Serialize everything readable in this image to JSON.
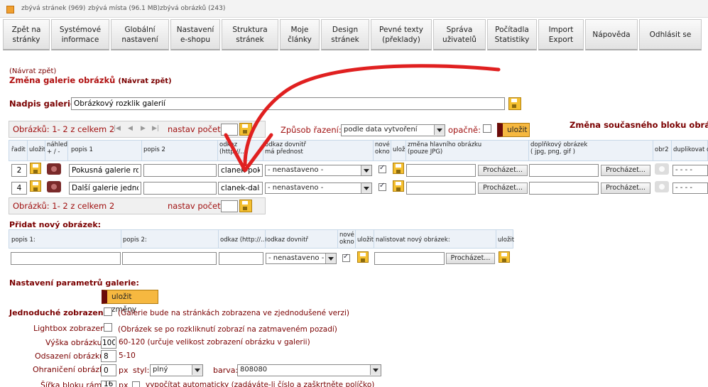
{
  "header": {
    "info": [
      "zbývá stránek (969)",
      "zbývá místa (96.1 MB)",
      "zbývá obrázků (243)"
    ]
  },
  "nav": [
    {
      "label": "Zpět na\nstránky"
    },
    {
      "label": "Systémové\ninformace"
    },
    {
      "label": "Globální\nnastavení"
    },
    {
      "label": "Nastavení\ne-shopu"
    },
    {
      "label": "Struktura\nstránek"
    },
    {
      "label": "Moje\nčlánky"
    },
    {
      "label": "Design\nstránek"
    },
    {
      "label": "Pevné texty\n(překlady)"
    },
    {
      "label": "Správa\nuživatelů"
    },
    {
      "label": "Počítadla\nStatistiky"
    },
    {
      "label": "Import\nExport"
    },
    {
      "label": "Nápověda"
    },
    {
      "label": "Odhlásit se"
    }
  ],
  "back_link": "(Návrat zpět)",
  "section_title": "Změna galerie obrázků",
  "section_back": "(Návrat zpět)",
  "gallery_title_label": "Nadpis galerie:",
  "gallery_title_value": "Obrázkový rozklik galerií",
  "pager": {
    "summary": "Obrázků: 1- 2 z celkem 2",
    "set_count_label": "nastav počet:"
  },
  "sort": {
    "label": "Způsob řazení:",
    "value": "podle data vytvoření",
    "reverse_label": "opačně:",
    "save_label": "uložit"
  },
  "right_heading": "Změna současného bloku obrázků",
  "columns": {
    "order": "řadit",
    "save": "uložit",
    "preview": "náhled\n+ / -",
    "desc1": "popis 1",
    "desc2": "popis 2",
    "link": "odkaz\n(http://...)",
    "inner_link": "odkaz dovnitř\nmá přednost",
    "new_window": "nové\nokno",
    "save2": "ulož",
    "main_image": "změna hlavního obrázku\n(pouze JPG)",
    "extra_image": "doplňkový obrázek\n( jpg, png, gif )",
    "img2": "obr2",
    "duplicate": "duplikovat d"
  },
  "rows": [
    {
      "order": "2",
      "desc1": "Pokusná galerie rozš",
      "desc2": "",
      "link": "clanek-pokus",
      "inner": "- nenastaveno -",
      "browse": "Procházet...",
      "browse2": "Procházet...",
      "dup": "- - - -"
    },
    {
      "order": "4",
      "desc1": "Další galerie jednodu",
      "desc2": "",
      "link": "clanek-dalsi-",
      "inner": "- nenastaveno -",
      "browse": "Procházet...",
      "browse2": "Procházet...",
      "dup": "- - - -"
    }
  ],
  "new_image": {
    "title": "Přidat nový obrázek:",
    "cols": {
      "desc1": "popis 1:",
      "desc2": "popis 2:",
      "link": "odkaz (http://..)",
      "inner": "odkaz dovnitř",
      "new_window": "nové\nokno",
      "save": "uložit",
      "upload": "nalistovat nový obrázek:",
      "save2": "uložit"
    },
    "inner_value": "- nenastaveno -",
    "browse": "Procházet..."
  },
  "params": {
    "title": "Nastavení parametrů galerie:",
    "save_label": "uložit změny",
    "simple_label": "Jednoduché zobrazení",
    "simple_note": "(Galerie bude na stránkách zobrazena ve zjednodušené verzi)",
    "lightbox_label": "Lightbox zobrazení",
    "lightbox_note": "(Obrázek se po rozkliknutí zobrazí na zatmaveném pozadí)",
    "height_label": "Výška obrázku:",
    "height_value": "100",
    "height_note": "60-120 (určuje velikost zobrazení obrázku v galerii)",
    "offset_label": "Odsazení obrázku:",
    "offset_value": "8",
    "offset_note": "5-10",
    "border_label": "Ohraničení obrázku",
    "border_value": "0",
    "border_unit": "px",
    "style_label": "styl:",
    "style_value": "plný",
    "color_label": "barva:",
    "color_value": "808080",
    "frame_label": "Šířka bloku rámu:",
    "frame_value": "160",
    "frame_unit": "px",
    "frame_note": "vypočítat automaticky (zadáváte-li číslo a zaškrtněte políčko)"
  },
  "colors": {
    "accent": "#b01010",
    "annotation": "#e02020",
    "save_button": "#f6b840"
  }
}
